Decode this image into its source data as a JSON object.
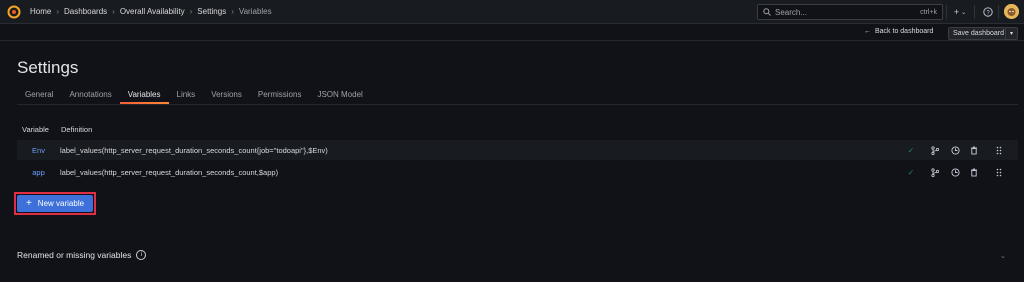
{
  "breadcrumbs": [
    "Home",
    "Dashboards",
    "Overall Availability",
    "Settings",
    "Variables"
  ],
  "search": {
    "placeholder": "Search...",
    "shortcut": "ctrl+k"
  },
  "toolbar": {
    "back_label": "Back to dashboard",
    "save_label": "Save dashboard"
  },
  "page_title": "Settings",
  "tabs": [
    "General",
    "Annotations",
    "Variables",
    "Links",
    "Versions",
    "Permissions",
    "JSON Model"
  ],
  "active_tab": "Variables",
  "table": {
    "headers": [
      "Variable",
      "Definition"
    ],
    "rows": [
      {
        "name": "Env",
        "definition": "label_values(http_server_request_duration_seconds_count{job=\"todoapi\"},$Env)"
      },
      {
        "name": "app",
        "definition": "label_values(http_server_request_duration_seconds_count,$app)"
      }
    ]
  },
  "new_variable_label": "New variable",
  "renamed_section_title": "Renamed or missing variables",
  "colors": {
    "accent": "#3d71d9",
    "highlight_outline": "#e02f44",
    "link": "#6e9fff",
    "ok": "#1b855e"
  },
  "icons": [
    "grafana-logo-icon",
    "search-icon",
    "plus-icon",
    "help-icon",
    "avatar",
    "check-icon",
    "branch-icon",
    "duplicate-icon",
    "trash-icon",
    "drag-handle-icon",
    "info-icon",
    "chevron-down-icon"
  ]
}
